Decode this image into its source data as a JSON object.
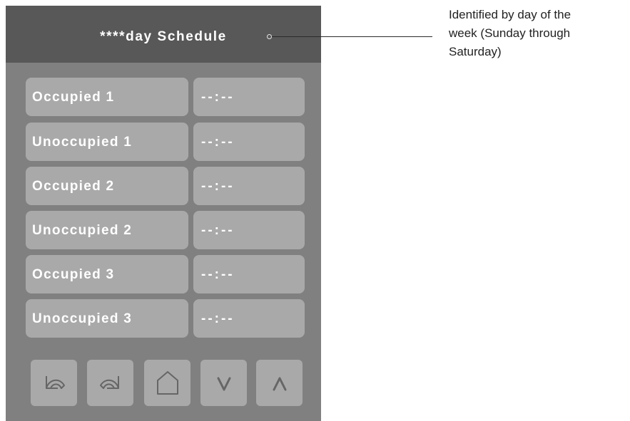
{
  "header": {
    "title": "****day Schedule"
  },
  "schedule": {
    "rows": [
      {
        "label": "Occupied 1",
        "value": "--:--"
      },
      {
        "label": "Unoccupied 1",
        "value": "--:--"
      },
      {
        "label": "Occupied 2",
        "value": "--:--"
      },
      {
        "label": "Unoccupied 2",
        "value": "--:--"
      },
      {
        "label": "Occupied 3",
        "value": "--:--"
      },
      {
        "label": "Unoccupied 3",
        "value": "--:--"
      }
    ]
  },
  "toolbar": {
    "buttons": [
      {
        "icon": "undo-icon"
      },
      {
        "icon": "redo-icon"
      },
      {
        "icon": "home-icon"
      },
      {
        "icon": "chevron-down-icon"
      },
      {
        "icon": "chevron-up-icon"
      }
    ]
  },
  "callout": {
    "text": "Identified by day of the\nweek (Sunday through\nSaturday)"
  },
  "colors": {
    "panel_background": "#808080",
    "header_background": "#585858",
    "button_background": "#a9a9a9",
    "icon_stroke": "#666666",
    "text": "#ffffff"
  }
}
